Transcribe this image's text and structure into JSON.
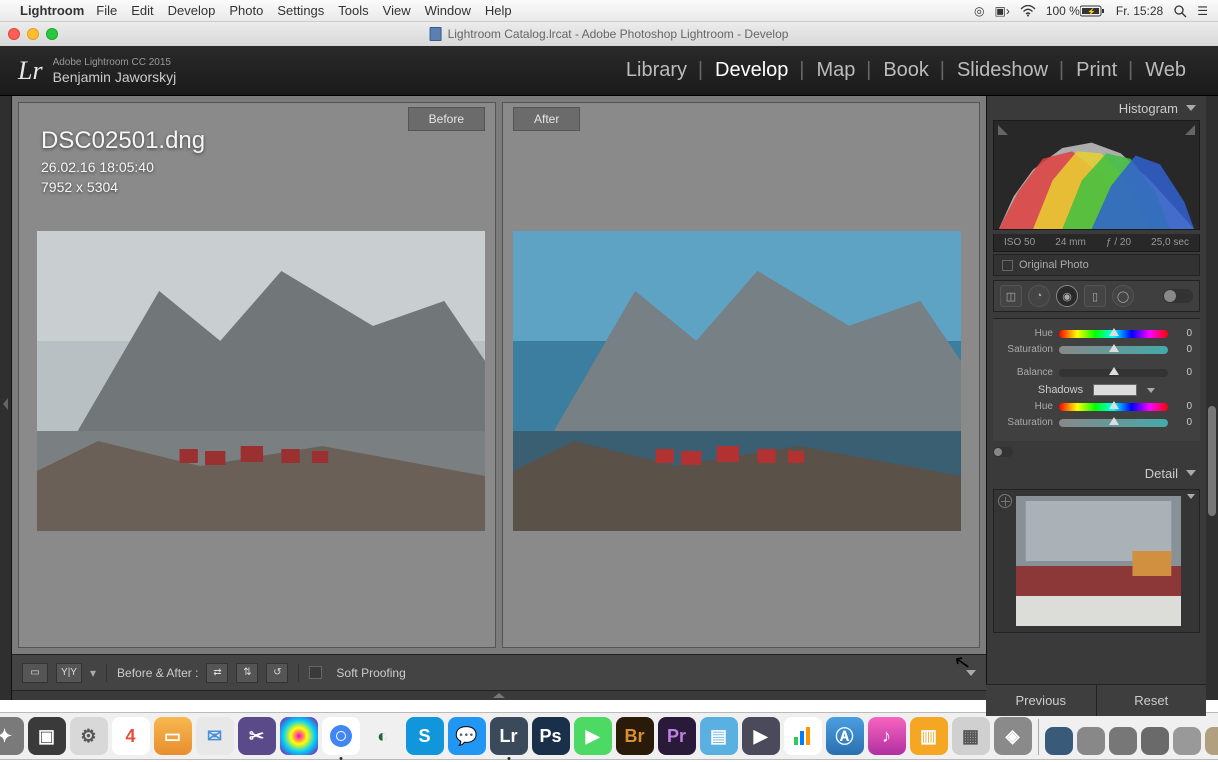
{
  "mac_menu": {
    "app": "Lightroom",
    "items": [
      "File",
      "Edit",
      "Develop",
      "Photo",
      "Settings",
      "Tools",
      "View",
      "Window",
      "Help"
    ],
    "battery": "100 %",
    "clock": "Fr. 15:28"
  },
  "window_title": "Lightroom Catalog.lrcat - Adobe Photoshop Lightroom - Develop",
  "lr_header": {
    "product": "Adobe Lightroom CC 2015",
    "user": "Benjamin Jaworskyj",
    "modules": [
      "Library",
      "Develop",
      "Map",
      "Book",
      "Slideshow",
      "Print",
      "Web"
    ],
    "active_module": "Develop"
  },
  "preview": {
    "before_label": "Before",
    "after_label": "After",
    "filename": "DSC02501.dng",
    "datetime": "26.02.16 18:05:40",
    "dimensions": "7952 x 5304"
  },
  "toolbar": {
    "before_after_label": "Before & After :",
    "soft_proofing": "Soft Proofing"
  },
  "right": {
    "histogram_title": "Histogram",
    "iso": "ISO 50",
    "focal": "24 mm",
    "aperture": "ƒ / 20",
    "shutter": "25,0 sec",
    "original_photo": "Original Photo",
    "sliders": {
      "hue": "Hue",
      "hue_val": "0",
      "sat": "Saturation",
      "sat_val": "0",
      "balance": "Balance",
      "balance_val": "0",
      "shadows": "Shadows",
      "hue2": "Hue",
      "hue2_val": "0",
      "sat2": "Saturation",
      "sat2_val": "0"
    },
    "detail_title": "Detail",
    "previous": "Previous",
    "reset": "Reset"
  }
}
